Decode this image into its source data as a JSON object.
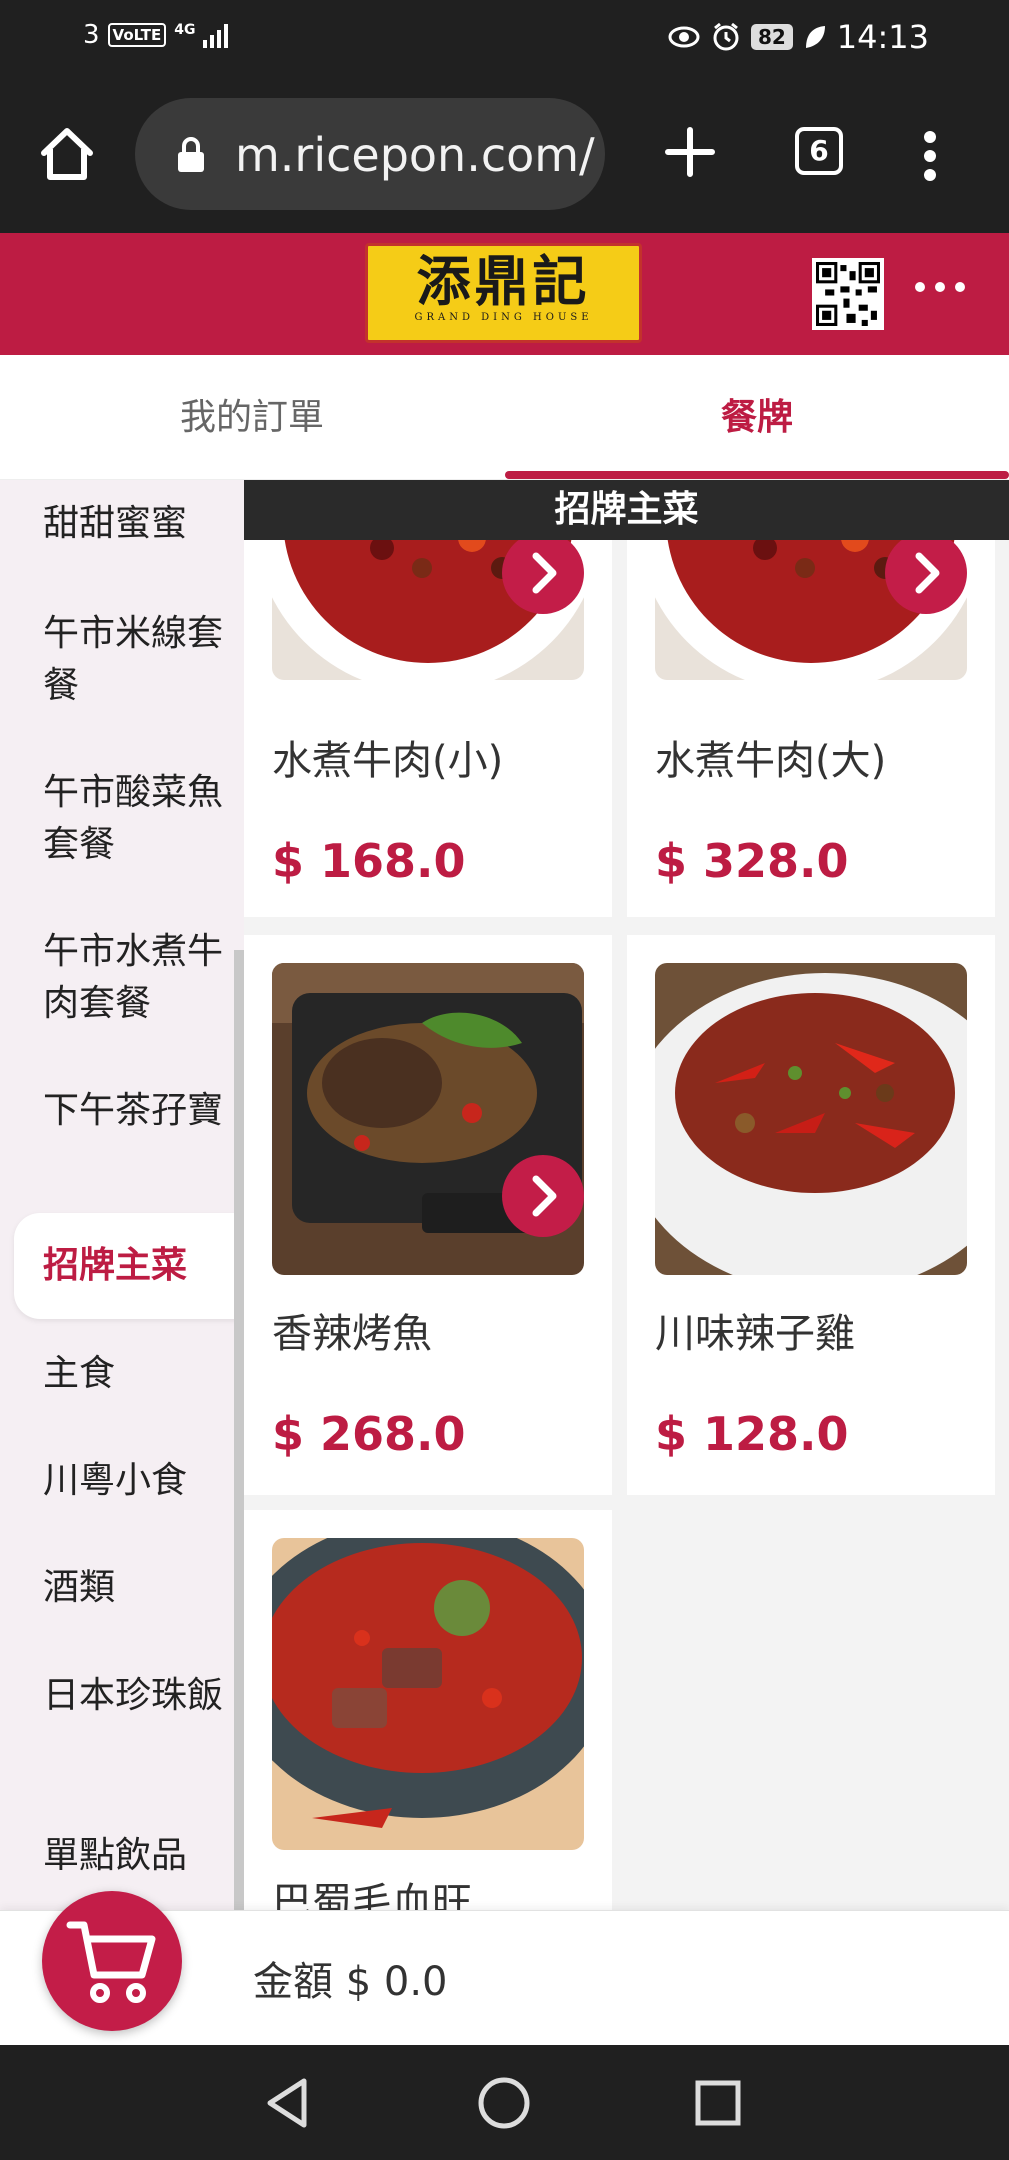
{
  "status_bar": {
    "sim": "3",
    "volte": "VoLTE",
    "network": "4G",
    "battery": "82",
    "time": "14:13",
    "icons": [
      "eye-comfort-icon",
      "alarm-icon",
      "battery-icon",
      "leaf-icon",
      "signal-icon"
    ]
  },
  "browser": {
    "url": "m.ricepon.com/",
    "tab_count": "6",
    "icons": [
      "home-icon",
      "lock-icon",
      "plus-icon",
      "tabs-icon",
      "menu-dots-icon"
    ]
  },
  "header": {
    "logo_title": "添鼎記",
    "logo_subtitle": "GRAND DING HOUSE",
    "brand_color": "#bd1c43",
    "icons": [
      "qr-code-icon",
      "more-icon"
    ]
  },
  "tabs": [
    {
      "label": "我的訂單",
      "active": false
    },
    {
      "label": "餐牌",
      "active": true
    }
  ],
  "sidebar": {
    "items": [
      {
        "label": "甜甜蜜蜜",
        "active": false
      },
      {
        "label": "午市米線套餐",
        "active": false
      },
      {
        "label": "午市酸菜魚套餐",
        "active": false
      },
      {
        "label": "午市水煮牛肉套餐",
        "active": false
      },
      {
        "label": "下午茶孖寶",
        "active": false
      },
      {
        "label": "招牌主菜",
        "active": true
      },
      {
        "label": "主食",
        "active": false
      },
      {
        "label": "川粵小食",
        "active": false
      },
      {
        "label": "酒類",
        "active": false
      },
      {
        "label": "日本珍珠飯",
        "active": false
      },
      {
        "label": "單點飲品",
        "active": false
      }
    ]
  },
  "section": {
    "title": "招牌主菜"
  },
  "menu_items": [
    {
      "name": "水煮牛肉(小)",
      "price": "$ 168.0",
      "has_options_button": true,
      "image": "spicy-boiled-beef-photo"
    },
    {
      "name": "水煮牛肉(大)",
      "price": "$ 328.0",
      "has_options_button": true,
      "image": "spicy-boiled-beef-photo"
    },
    {
      "name": "香辣烤魚",
      "price": "$ 268.0",
      "has_options_button": true,
      "image": "grilled-fish-photo"
    },
    {
      "name": "川味辣子雞",
      "price": "$ 128.0",
      "has_options_button": false,
      "image": "chili-chicken-photo"
    },
    {
      "name": "巴蜀毛血旺",
      "price": "",
      "has_options_button": false,
      "image": "duck-blood-stew-photo"
    }
  ],
  "cart": {
    "total_label": "金額 $ 0.0",
    "icon": "cart-icon"
  },
  "nav": {
    "icons": [
      "back-icon",
      "home-circle-icon",
      "recents-icon"
    ]
  }
}
